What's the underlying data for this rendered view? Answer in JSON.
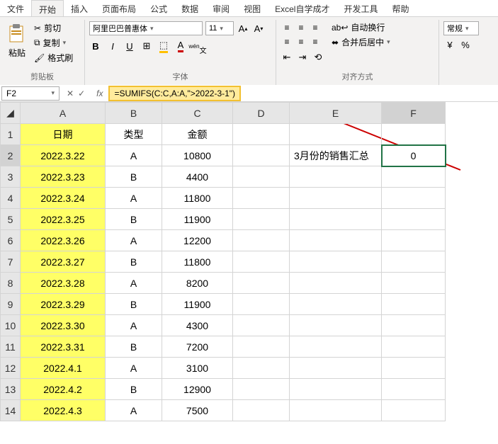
{
  "tabs": [
    "文件",
    "开始",
    "插入",
    "页面布局",
    "公式",
    "数据",
    "审阅",
    "视图",
    "Excel自学成才",
    "开发工具",
    "帮助"
  ],
  "active_tab": 1,
  "ribbon": {
    "clipboard": {
      "paste": "粘贴",
      "cut": "剪切",
      "copy": "复制",
      "format_painter": "格式刷",
      "label": "剪贴板"
    },
    "font": {
      "family": "阿里巴巴普惠体",
      "size": "11",
      "label": "字体"
    },
    "align": {
      "wrap": "自动换行",
      "merge": "合并后居中",
      "label": "对齐方式"
    },
    "number": {
      "format": "常规"
    }
  },
  "namebox": "F2",
  "formula": "=SUMIFS(C:C,A:A,\">2022-3-1\")",
  "columns": [
    "A",
    "B",
    "C",
    "D",
    "E",
    "F"
  ],
  "headers": {
    "A": "日期",
    "B": "类型",
    "C": "金额"
  },
  "side_label": "3月份的销售汇总",
  "result": "0",
  "rows": [
    {
      "n": 2,
      "date": "2022.3.22",
      "type": "A",
      "amt": "10800"
    },
    {
      "n": 3,
      "date": "2022.3.23",
      "type": "B",
      "amt": "4400"
    },
    {
      "n": 4,
      "date": "2022.3.24",
      "type": "A",
      "amt": "11800"
    },
    {
      "n": 5,
      "date": "2022.3.25",
      "type": "B",
      "amt": "11900"
    },
    {
      "n": 6,
      "date": "2022.3.26",
      "type": "A",
      "amt": "12200"
    },
    {
      "n": 7,
      "date": "2022.3.27",
      "type": "B",
      "amt": "11800"
    },
    {
      "n": 8,
      "date": "2022.3.28",
      "type": "A",
      "amt": "8200"
    },
    {
      "n": 9,
      "date": "2022.3.29",
      "type": "B",
      "amt": "11900"
    },
    {
      "n": 10,
      "date": "2022.3.30",
      "type": "A",
      "amt": "4300"
    },
    {
      "n": 11,
      "date": "2022.3.31",
      "type": "B",
      "amt": "7200"
    },
    {
      "n": 12,
      "date": "2022.4.1",
      "type": "A",
      "amt": "3100"
    },
    {
      "n": 13,
      "date": "2022.4.2",
      "type": "B",
      "amt": "12900"
    },
    {
      "n": 14,
      "date": "2022.4.3",
      "type": "A",
      "amt": "7500"
    }
  ]
}
